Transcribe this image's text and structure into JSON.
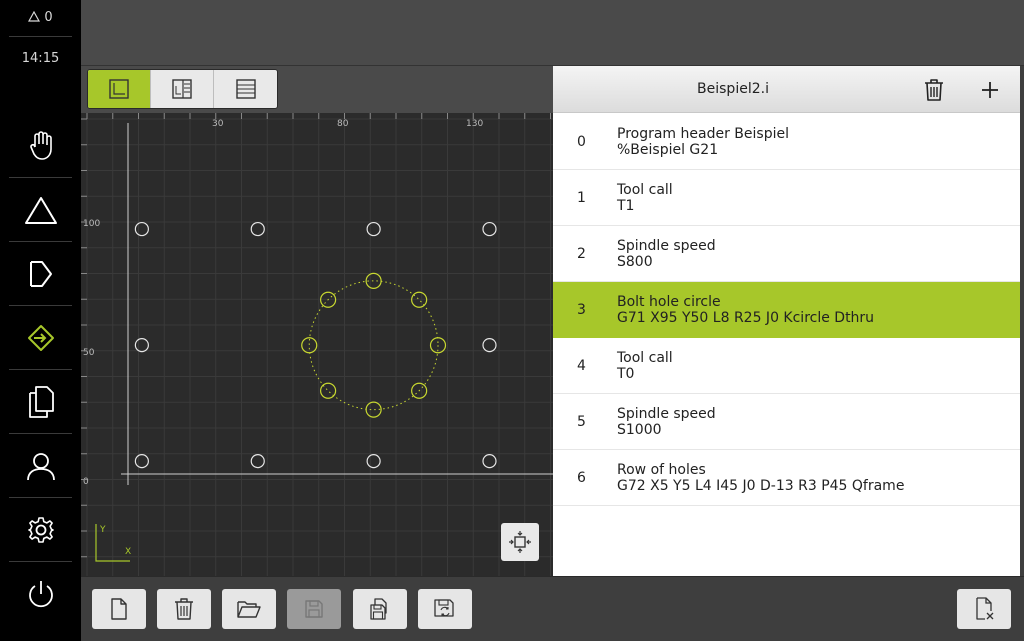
{
  "status": {
    "warnings_count": "0",
    "time": "14:15"
  },
  "sidebar": {
    "items": [
      {
        "id": "manual",
        "icon": "hand-icon"
      },
      {
        "id": "mdi",
        "icon": "triangle-icon"
      },
      {
        "id": "run",
        "icon": "program-run-icon"
      },
      {
        "id": "programming",
        "icon": "programming-icon",
        "active": true
      },
      {
        "id": "file-management",
        "icon": "files-icon"
      },
      {
        "id": "user-login",
        "icon": "user-icon"
      },
      {
        "id": "settings",
        "icon": "gear-icon"
      },
      {
        "id": "switch-off",
        "icon": "power-icon"
      }
    ]
  },
  "view_toggle": {
    "buttons": [
      {
        "id": "graphic",
        "icon": "graphic-view-icon",
        "active": true
      },
      {
        "id": "split",
        "icon": "split-view-icon",
        "active": false
      },
      {
        "id": "list",
        "icon": "list-view-icon",
        "active": false
      }
    ]
  },
  "ruler": {
    "x_labels": [
      "30",
      "80",
      "130"
    ],
    "y_labels": [
      "100",
      "50",
      "0"
    ]
  },
  "axis_labels": {
    "x": "X",
    "y": "Y"
  },
  "program": {
    "title": "Beispiel2.i",
    "selected_index": 3,
    "rows": [
      {
        "index": "0",
        "name": "Program header Beispiel",
        "code": "%Beispiel G21"
      },
      {
        "index": "1",
        "name": "Tool call",
        "code": "T1"
      },
      {
        "index": "2",
        "name": "Spindle speed",
        "code": "S800"
      },
      {
        "index": "3",
        "name": "Bolt hole circle",
        "code": "G71 X95 Y50 L8 R25 J0 Kcircle Dthru"
      },
      {
        "index": "4",
        "name": "Tool call",
        "code": "T0"
      },
      {
        "index": "5",
        "name": "Spindle speed",
        "code": "S1000"
      },
      {
        "index": "6",
        "name": "Row of holes",
        "code": "G72 X5 Y5 L4 I45 J0 D-13 R3 P45 Qframe"
      }
    ]
  },
  "bottom_toolbar": {
    "buttons": [
      {
        "id": "new",
        "icon": "new-file-icon",
        "enabled": true
      },
      {
        "id": "delete",
        "icon": "trash-icon",
        "enabled": true
      },
      {
        "id": "open",
        "icon": "folder-open-icon",
        "enabled": true
      },
      {
        "id": "save",
        "icon": "save-icon",
        "enabled": false
      },
      {
        "id": "save-as",
        "icon": "save-as-icon",
        "enabled": true
      },
      {
        "id": "save-reload",
        "icon": "save-reload-icon",
        "enabled": true
      },
      {
        "id": "close-program",
        "icon": "close-program-icon",
        "enabled": true
      }
    ]
  },
  "colors": {
    "accent": "#a7c72a",
    "background": "#2b2b2b",
    "grid_line": "#3a3a3a",
    "hole_plain": "#e6e6e6",
    "hole_selected": "#c8d830"
  }
}
